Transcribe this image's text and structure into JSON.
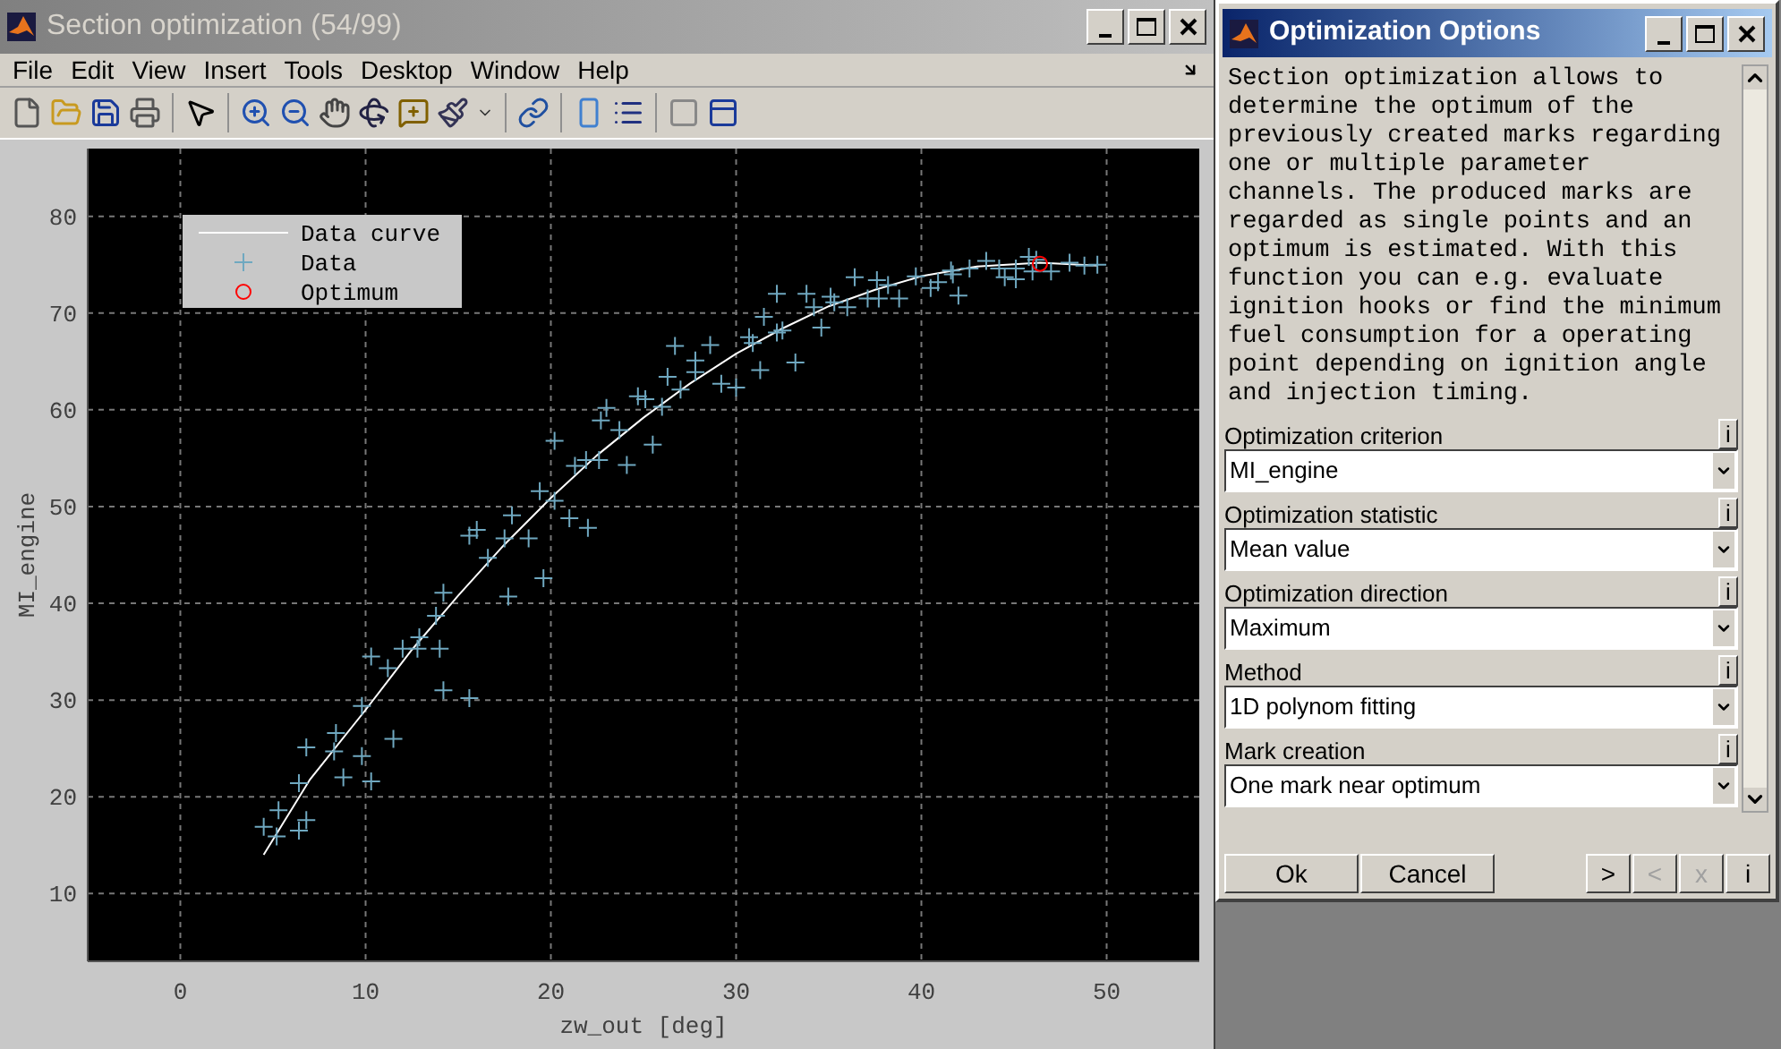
{
  "figure_window": {
    "title": "Section optimization (54/99)",
    "menu": [
      "File",
      "Edit",
      "View",
      "Insert",
      "Tools",
      "Desktop",
      "Window",
      "Help"
    ],
    "chart_data": {
      "type": "scatter",
      "xlabel": "zw_out [deg]",
      "ylabel": "MI_engine",
      "xlim": [
        -5,
        55
      ],
      "ylim": [
        3,
        87
      ],
      "xticks": [
        0,
        10,
        20,
        30,
        40,
        50
      ],
      "yticks": [
        10,
        20,
        30,
        40,
        50,
        60,
        70,
        80
      ],
      "grid": true,
      "legend": "upper left",
      "series": [
        {
          "name": "Data curve",
          "type": "line",
          "color": "#ffffff",
          "x": [
            4.5,
            7,
            10,
            12.5,
            15,
            17.5,
            20,
            22.5,
            25,
            27.5,
            30,
            32.5,
            35,
            37.5,
            40,
            43,
            46.4,
            49.5
          ],
          "values": [
            14.0,
            21.8,
            29.0,
            35.2,
            40.8,
            46.1,
            50.9,
            55.3,
            59.2,
            62.7,
            65.8,
            68.4,
            70.7,
            72.4,
            73.8,
            74.8,
            75.2,
            74.9
          ]
        },
        {
          "name": "Data",
          "type": "scatter",
          "marker": "+",
          "color": "#6fa8c0",
          "x": [
            4.5,
            5.3,
            5.2,
            6.4,
            6.8,
            6.4,
            6.8,
            8.4,
            8.3,
            8.8,
            9.8,
            10.3,
            9.8,
            10.3,
            11.2,
            11.5,
            12,
            12.9,
            12.8,
            14,
            13.8,
            14.2,
            14.2,
            15.6,
            15.6,
            16,
            16.6,
            17.7,
            17.5,
            17.9,
            18.8,
            19.4,
            19.6,
            20.2,
            20.2,
            21,
            21.3,
            21.9,
            22,
            22.6,
            22.7,
            23,
            23.7,
            24.1,
            25.5,
            24.7,
            25.1,
            26,
            26.3,
            27,
            26.7,
            27.8,
            27.8,
            28.6,
            29.2,
            30,
            30.7,
            30.9,
            31.3,
            31.5,
            32.2,
            32.5,
            32.2,
            33.2,
            33.8,
            34.2,
            34.6,
            35.1,
            35.3,
            36,
            36.4,
            37.1,
            37.6,
            37.7,
            38.2,
            38.8,
            39.7,
            40.5,
            40.9,
            41.6,
            41.7,
            42,
            42.6,
            43.5,
            44.2,
            44.5,
            45.1,
            45.1,
            45.8,
            46.2,
            46,
            47,
            48,
            48.8,
            49.5
          ],
          "values": [
            16.9,
            18.6,
            15.9,
            16.5,
            17.6,
            21.4,
            25.1,
            26.6,
            24.7,
            22,
            24.2,
            21.6,
            29.4,
            34.5,
            33.3,
            26,
            35.3,
            36.5,
            35.3,
            35.3,
            38.7,
            41.1,
            31,
            30.2,
            47,
            47.6,
            44.7,
            40.7,
            46.7,
            49.1,
            46.7,
            51.6,
            42.6,
            56.8,
            50.6,
            48.8,
            54.2,
            54.8,
            47.8,
            54.8,
            58.9,
            60.2,
            57.9,
            54.3,
            56.4,
            61.4,
            61.1,
            60.3,
            63.4,
            62.1,
            66.6,
            65.1,
            63.9,
            66.7,
            62.7,
            62.3,
            67.5,
            66.9,
            64.1,
            69.6,
            68,
            68.2,
            72,
            64.9,
            72,
            70.6,
            68.5,
            71.7,
            71.1,
            70.6,
            73.7,
            71.5,
            73.4,
            71.5,
            72.9,
            71.5,
            73.8,
            72.6,
            73.2,
            74.4,
            74,
            71.8,
            74.6,
            75.4,
            74.6,
            73.7,
            73.5,
            74.6,
            75.8,
            75.5,
            74.3,
            74.3,
            75.2,
            74.9,
            75
          ]
        },
        {
          "name": "Optimum",
          "type": "scatter",
          "marker": "o",
          "color": "#ff0000",
          "x": [
            46.4
          ],
          "values": [
            75.1
          ]
        }
      ]
    }
  },
  "options_dialog": {
    "title": "Optimization Options",
    "description": "Section optimization allows to determine the optimum of the previously created marks regarding one or multiple parameter channels. The produced marks are regarded as single points and an optimum is estimated. With this function you can e.g. evaluate ignition hooks or find the minimum fuel consumption for a operating point depending on ignition angle and injection timing.",
    "fields": [
      {
        "label": "Optimization criterion",
        "info": "i",
        "value": "MI_engine"
      },
      {
        "label": "Optimization statistic",
        "info": "i",
        "value": "Mean value"
      },
      {
        "label": "Optimization direction",
        "info": "i",
        "value": "Maximum"
      },
      {
        "label": "Method",
        "info": "i",
        "value": "1D polynom fitting"
      },
      {
        "label": "Mark creation",
        "info": "i",
        "value": "One mark near optimum"
      }
    ],
    "buttons": [
      {
        "label": "Ok",
        "disabled": false
      },
      {
        "label": "Cancel",
        "disabled": false
      }
    ],
    "nav_buttons": [
      {
        "label": ">",
        "disabled": false
      },
      {
        "label": "<",
        "disabled": true
      },
      {
        "label": "x",
        "disabled": true
      },
      {
        "label": "i",
        "disabled": false
      }
    ]
  }
}
